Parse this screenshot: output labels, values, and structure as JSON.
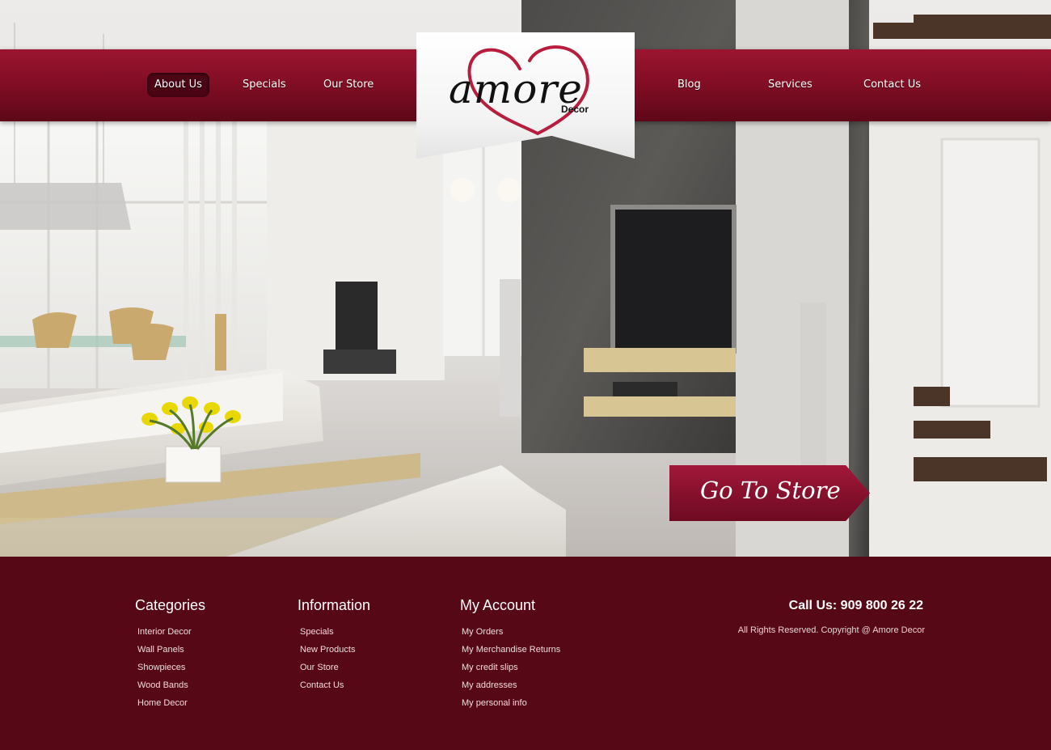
{
  "brand": {
    "logo_text": "amore",
    "logo_sub": "Decor",
    "accent_color": "#8a1029",
    "footer_color": "#560816"
  },
  "nav": {
    "left": [
      {
        "label": "About Us",
        "active": true
      },
      {
        "label": "Specials"
      },
      {
        "label": "Our Store"
      }
    ],
    "right": [
      {
        "label": "Blog"
      },
      {
        "label": "Services"
      },
      {
        "label": "Contact Us"
      }
    ]
  },
  "hero": {
    "cta_label": "Go To Store"
  },
  "footer": {
    "categories": {
      "title": "Categories",
      "items": [
        "Interior Decor",
        "Wall Panels",
        "Showpieces",
        "Wood Bands",
        "Home Decor"
      ]
    },
    "information": {
      "title": "Information",
      "items": [
        "Specials",
        "New Products",
        "Our Store",
        "Contact Us"
      ]
    },
    "account": {
      "title": "My Account",
      "items": [
        "My Orders",
        "My Merchandise Returns",
        "My credit slips",
        "My addresses",
        "My personal info"
      ]
    },
    "call": "Call Us: 909 800 26 22",
    "copyright": "All Rights Reserved. Copyright @ Amore Decor"
  }
}
